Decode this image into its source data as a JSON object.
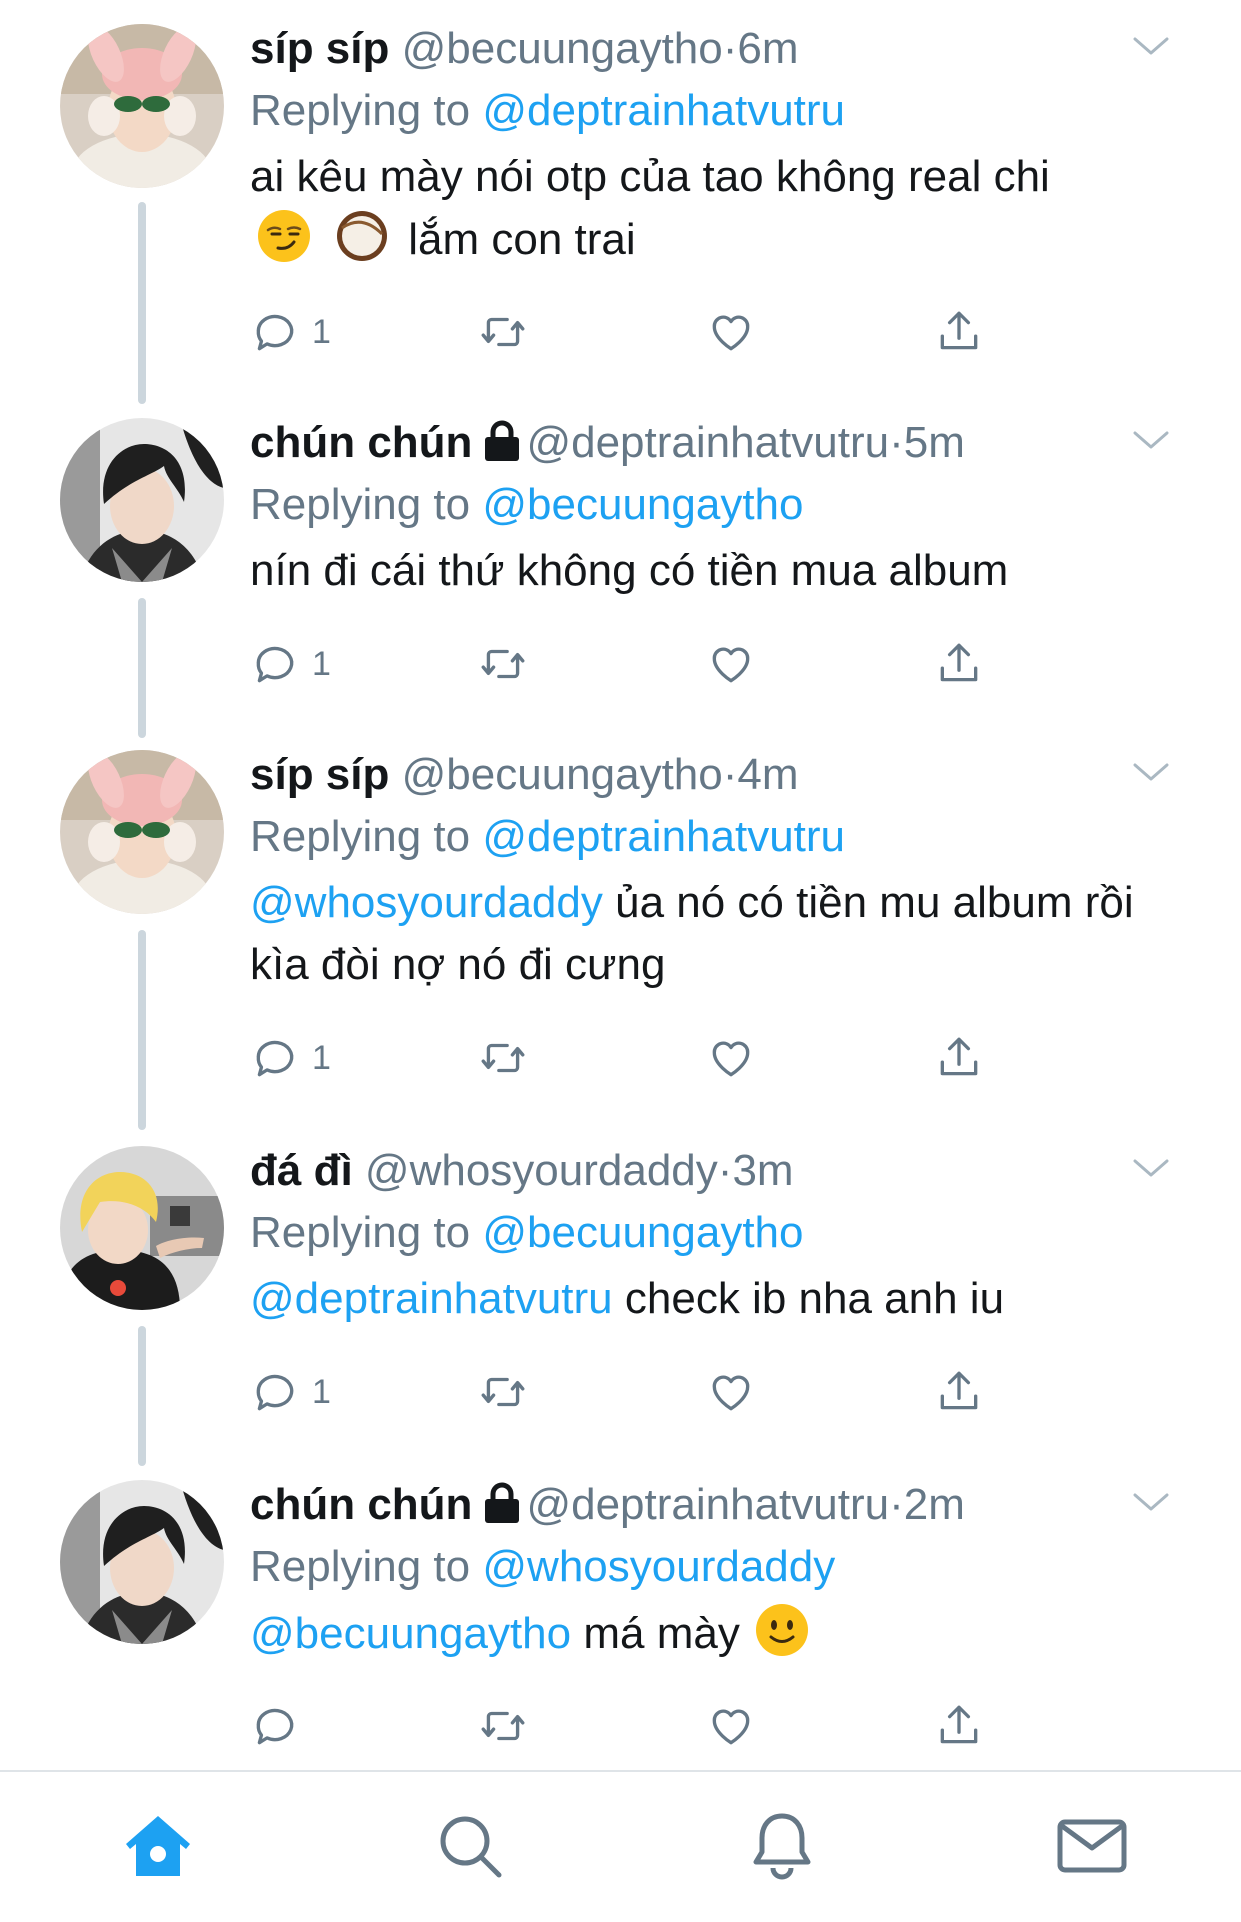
{
  "tweets": [
    {
      "name": "síp síp",
      "handle": "@becuungaytho",
      "time": "6m",
      "replying_label": "Replying to",
      "reply_to": "@deptrainhatvutru",
      "text_before": "ai kêu mày nói otp của tao không real chi",
      "emojis": [
        "smirking-face",
        "coconut"
      ],
      "text_after": "lắm con trai",
      "reply_count": "1",
      "locked": false
    },
    {
      "name": "chún chún",
      "handle": "@deptrainhatvutru",
      "time": "5m",
      "replying_label": "Replying to",
      "reply_to": "@becuungaytho",
      "text": "nín đi cái thứ không có tiền mua album",
      "reply_count": "1",
      "locked": true
    },
    {
      "name": "síp síp",
      "handle": "@becuungaytho",
      "time": "4m",
      "replying_label": "Replying to",
      "reply_to": "@deptrainhatvutru",
      "mention": "@whosyourdaddy",
      "text": "ủa nó có tiền mu album rồi kìa đòi nợ nó đi cưng",
      "reply_count": "1",
      "locked": false
    },
    {
      "name": "đá đì",
      "handle": "@whosyourdaddy",
      "time": "3m",
      "replying_label": "Replying to",
      "reply_to": "@becuungaytho",
      "mention": "@deptrainhatvutru",
      "text": "check ib nha anh iu",
      "reply_count": "1",
      "locked": false
    },
    {
      "name": "chún chún",
      "handle": "@deptrainhatvutru",
      "time": "2m",
      "replying_label": "Replying to",
      "reply_to": "@whosyourdaddy",
      "mention": "@becuungaytho",
      "text": "má mày",
      "emoji": "slightly-smiling-face",
      "reply_count": "",
      "locked": true
    }
  ],
  "separator": "·",
  "tabs": [
    "home-icon",
    "search-icon",
    "notifications-icon",
    "messages-icon"
  ],
  "colors": {
    "link": "#1da1f2",
    "secondary": "#657786",
    "thread_line": "#ccd6dd",
    "tab_active": "#1da1f2"
  }
}
